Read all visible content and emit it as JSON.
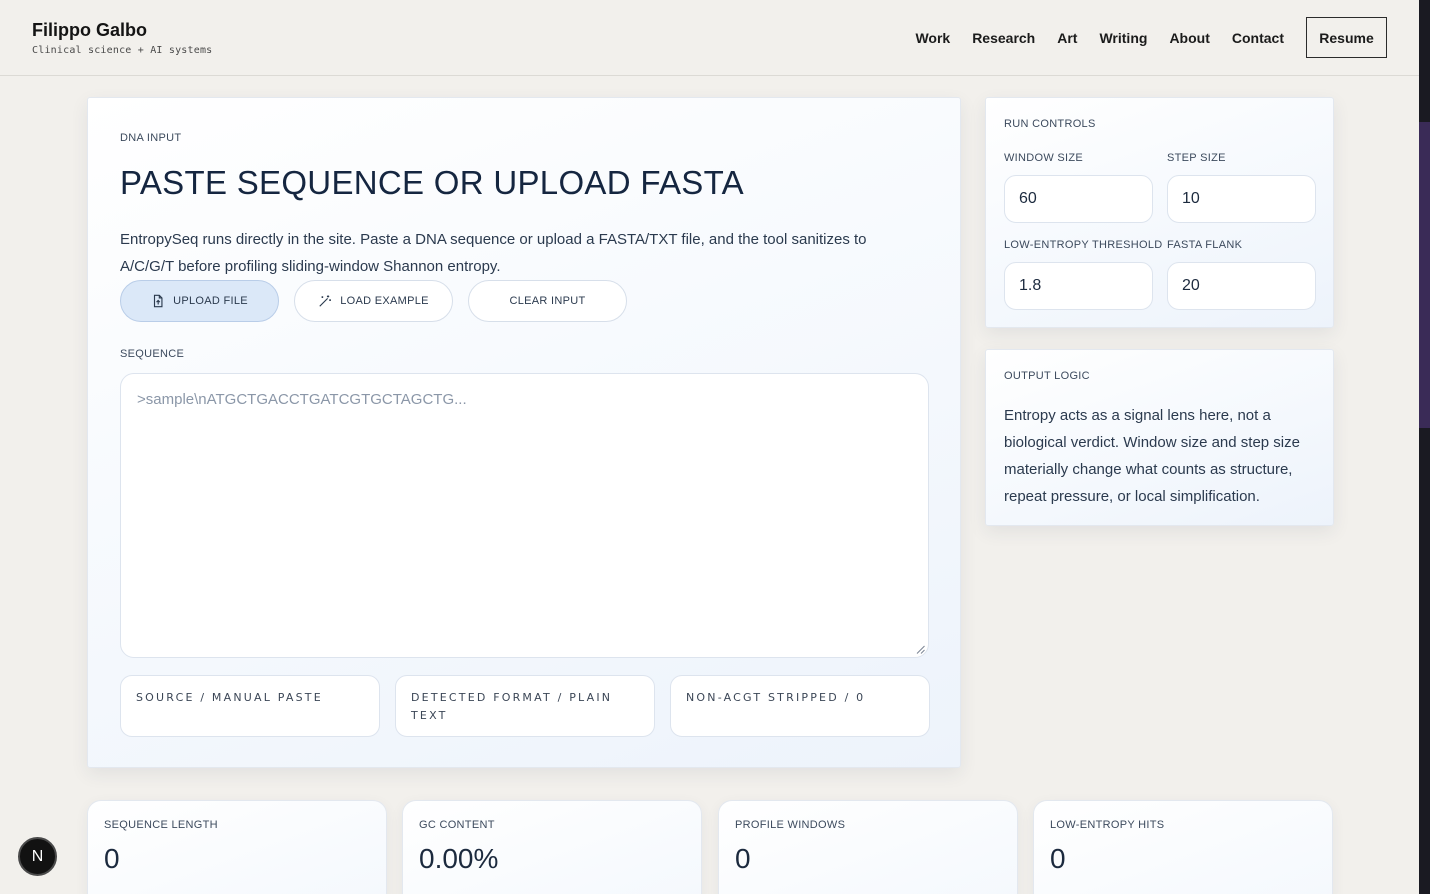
{
  "header": {
    "brand_name": "Filippo Galbo",
    "brand_tagline": "Clinical science + AI systems",
    "nav": [
      "Work",
      "Research",
      "Art",
      "Writing",
      "About",
      "Contact"
    ],
    "resume_label": "Resume"
  },
  "input_card": {
    "eyebrow": "DNA INPUT",
    "title": "PASTE SEQUENCE OR UPLOAD FASTA",
    "description": "EntropySeq runs directly in the site. Paste a DNA sequence or upload a FASTA/TXT file, and the tool sanitizes to A/C/G/T before profiling sliding-window Shannon entropy.",
    "buttons": {
      "upload": "UPLOAD FILE",
      "example": "LOAD EXAMPLE",
      "clear": "CLEAR INPUT"
    },
    "sequence_label": "SEQUENCE",
    "sequence_placeholder": ">sample\\nATGCTGACCTGATCGTGCTAGCTG...",
    "meta": {
      "source": "SOURCE / MANUAL PASTE",
      "format": "DETECTED FORMAT / PLAIN TEXT",
      "stripped": "NON-ACGT STRIPPED / 0"
    }
  },
  "controls": {
    "eyebrow": "RUN CONTROLS",
    "window_size_label": "WINDOW SIZE",
    "window_size": "60",
    "step_size_label": "STEP SIZE",
    "step_size": "10",
    "threshold_label": "LOW-ENTROPY THRESHOLD",
    "threshold": "1.8",
    "flank_label": "FASTA FLANK",
    "flank": "20"
  },
  "output_logic": {
    "eyebrow": "OUTPUT LOGIC",
    "text": "Entropy acts as a signal lens here, not a biological verdict. Window size and step size materially change what counts as structure, repeat pressure, or local simplification."
  },
  "stats": [
    {
      "label": "SEQUENCE LENGTH",
      "value": "0"
    },
    {
      "label": "GC CONTENT",
      "value": "0.00%"
    },
    {
      "label": "PROFILE WINDOWS",
      "value": "0"
    },
    {
      "label": "LOW-ENTROPY HITS",
      "value": "0"
    }
  ],
  "badge": "N",
  "colors": {
    "background": "#f2f0ec",
    "primary_button": "#dbe8f8",
    "text_dark": "#152640"
  },
  "icons": {
    "upload": "file-upload-icon",
    "example": "wand-icon",
    "resize": "resize-grip-icon"
  }
}
